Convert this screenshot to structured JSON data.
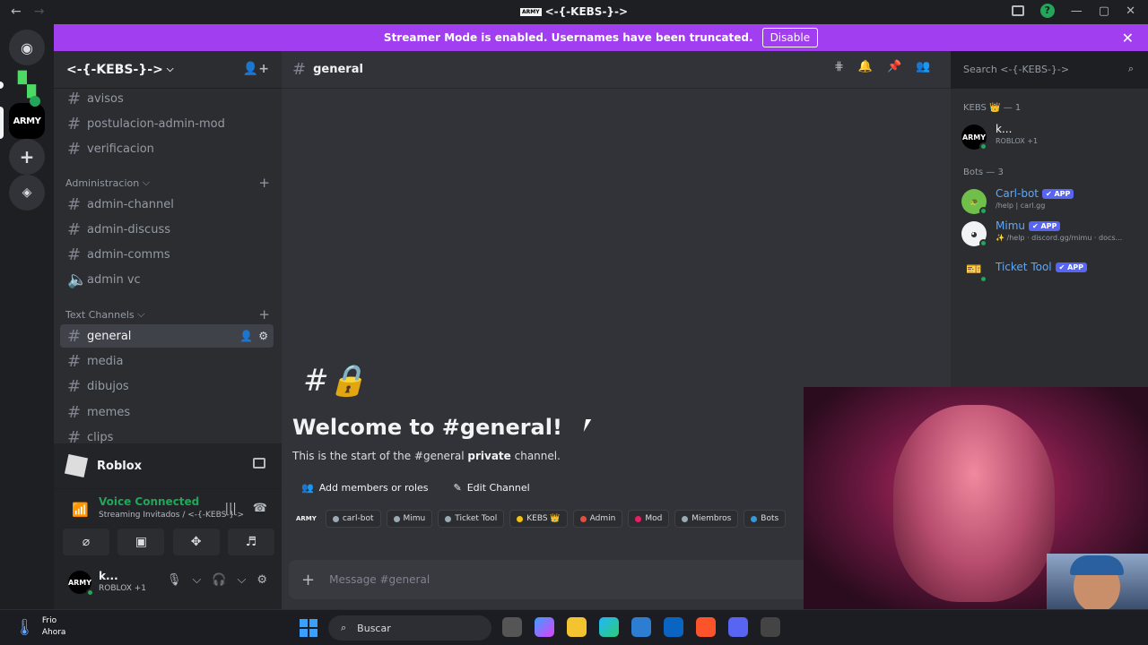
{
  "window": {
    "title": "<-{-KEBS-}->",
    "title_badge": "ARMY"
  },
  "nav": {
    "back": "←",
    "forward": "→"
  },
  "banner": {
    "text": "Streamer Mode is enabled. Usernames have been truncated.",
    "button": "Disable",
    "color": "#a13ef0"
  },
  "rail": {
    "server_badge": "ARMY"
  },
  "guild": {
    "name": "<-{-KEBS-}->"
  },
  "channels_top": [
    {
      "name": "avisos"
    },
    {
      "name": "postulacion-admin-mod"
    },
    {
      "name": "verificacion"
    }
  ],
  "category_admin": {
    "label": "Administracion"
  },
  "channels_admin": [
    {
      "name": "admin-channel"
    },
    {
      "name": "admin-discuss"
    },
    {
      "name": "admin-comms"
    },
    {
      "name": "admin vc"
    }
  ],
  "category_text": {
    "label": "Text Channels"
  },
  "channels_text": [
    {
      "name": "general"
    },
    {
      "name": "media"
    },
    {
      "name": "dibujos"
    },
    {
      "name": "memes"
    },
    {
      "name": "clips"
    }
  ],
  "activity": {
    "game": "Roblox"
  },
  "voice": {
    "status": "Voice Connected",
    "sub": "Streaming Invitados / <-{-KEBS-}->"
  },
  "user": {
    "name": "k...",
    "status": "ROBLOX +1",
    "avatar": "ARMY"
  },
  "chat": {
    "channel": "general",
    "welcome_title": "Welcome to #general!",
    "welcome_sub_pre": "This is the start of the #general ",
    "welcome_sub_bold": "private",
    "welcome_sub_post": " channel.",
    "btn_add": "Add members or roles",
    "btn_edit": "Edit Channel",
    "placeholder": "Message #general"
  },
  "roles": [
    {
      "name": "ARMY",
      "logo": true
    },
    {
      "name": "carl-bot",
      "color": "#99aab5"
    },
    {
      "name": "Mimu",
      "color": "#99aab5"
    },
    {
      "name": "Ticket Tool",
      "color": "#99aab5"
    },
    {
      "name": "KEBS 👑",
      "color": "#f1c40f"
    },
    {
      "name": "Admin",
      "color": "#e74c3c"
    },
    {
      "name": "Mod",
      "color": "#e91e63"
    },
    {
      "name": "Miembros",
      "color": "#99aab5"
    },
    {
      "name": "Bots",
      "color": "#3498db"
    }
  ],
  "search": {
    "placeholder": "Search <-{-KEBS-}->"
  },
  "members": {
    "group1": "KEBS 👑 — 1",
    "owner": {
      "name": "k...",
      "status": "ROBLOX +1",
      "avatar": "ARMY"
    },
    "group2": "Bots — 3",
    "bots": [
      {
        "name": "Carl-bot",
        "badge": "✔ APP",
        "status": "/help | carl.gg"
      },
      {
        "name": "Mimu",
        "badge": "✔ APP",
        "status": "✨ /help · discord.gg/mimu · docs..."
      },
      {
        "name": "Ticket Tool",
        "badge": "✔ APP",
        "status": ""
      }
    ]
  },
  "taskbar": {
    "weather_label": "Frio",
    "weather_time": "Ahora",
    "search": "Buscar"
  }
}
